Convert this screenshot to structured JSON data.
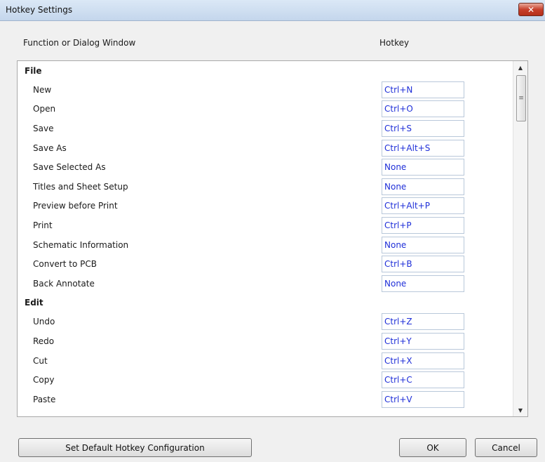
{
  "window": {
    "title": "Hotkey Settings"
  },
  "headers": {
    "function": "Function or Dialog Window",
    "hotkey": "Hotkey"
  },
  "sections": [
    {
      "name": "File",
      "items": [
        {
          "label": "New",
          "hotkey": "Ctrl+N"
        },
        {
          "label": "Open",
          "hotkey": "Ctrl+O"
        },
        {
          "label": "Save",
          "hotkey": "Ctrl+S"
        },
        {
          "label": "Save As",
          "hotkey": "Ctrl+Alt+S"
        },
        {
          "label": "Save Selected As",
          "hotkey": "None"
        },
        {
          "label": "Titles and Sheet Setup",
          "hotkey": "None"
        },
        {
          "label": "Preview before Print",
          "hotkey": "Ctrl+Alt+P"
        },
        {
          "label": "Print",
          "hotkey": "Ctrl+P"
        },
        {
          "label": "Schematic Information",
          "hotkey": "None"
        },
        {
          "label": "Convert to PCB",
          "hotkey": "Ctrl+B"
        },
        {
          "label": "Back Annotate",
          "hotkey": "None"
        }
      ]
    },
    {
      "name": "Edit",
      "items": [
        {
          "label": "Undo",
          "hotkey": "Ctrl+Z"
        },
        {
          "label": "Redo",
          "hotkey": "Ctrl+Y"
        },
        {
          "label": "Cut",
          "hotkey": "Ctrl+X"
        },
        {
          "label": "Copy",
          "hotkey": "Ctrl+C"
        },
        {
          "label": "Paste",
          "hotkey": "Ctrl+V"
        }
      ]
    }
  ],
  "buttons": {
    "default_label": "Set Default Hotkey Configuration",
    "ok_label": "OK",
    "cancel_label": "Cancel",
    "close_glyph": "✕"
  },
  "scrollbar": {
    "up_glyph": "▲",
    "down_glyph": "▼",
    "grip_glyph": "≡"
  },
  "colors": {
    "hotkey_text": "#1f2fd8",
    "close_button": "#c7402c"
  }
}
